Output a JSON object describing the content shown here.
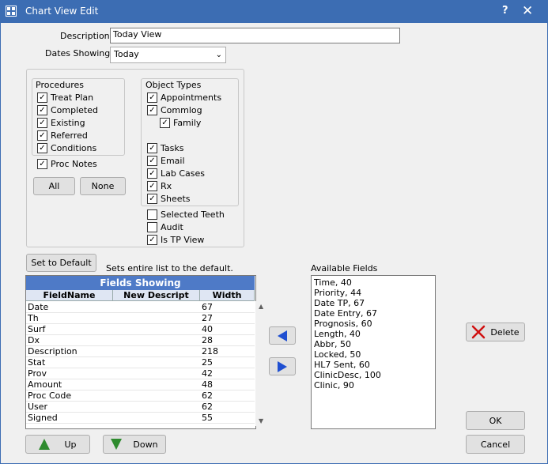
{
  "window": {
    "title": "Chart View Edit",
    "help_glyph": "?",
    "close_glyph": "✕"
  },
  "form": {
    "description_label": "Description",
    "description_value": "Today View",
    "dates_label": "Dates Showing",
    "dates_value": "Today"
  },
  "procedures": {
    "title": "Procedures",
    "items": [
      {
        "label": "Treat Plan",
        "checked": true
      },
      {
        "label": "Completed",
        "checked": true
      },
      {
        "label": "Existing",
        "checked": true
      },
      {
        "label": "Referred",
        "checked": true
      },
      {
        "label": "Conditions",
        "checked": true
      }
    ],
    "proc_notes": {
      "label": "Proc Notes",
      "checked": true
    },
    "all_label": "All",
    "none_label": "None"
  },
  "object_types": {
    "title": "Object Types",
    "items": [
      {
        "label": "Appointments",
        "checked": true
      },
      {
        "label": "Commlog",
        "checked": true
      },
      {
        "label": "Family",
        "checked": true
      },
      {
        "label": "Tasks",
        "checked": true
      },
      {
        "label": "Email",
        "checked": true
      },
      {
        "label": "Lab Cases",
        "checked": true
      },
      {
        "label": "Rx",
        "checked": true
      },
      {
        "label": "Sheets",
        "checked": true
      }
    ],
    "extras": [
      {
        "label": "Selected Teeth",
        "checked": false
      },
      {
        "label": "Audit",
        "checked": false
      },
      {
        "label": "Is TP View",
        "checked": true
      }
    ]
  },
  "defaults": {
    "button_label": "Set to Default",
    "hint": "Sets entire list to the default."
  },
  "fields_showing": {
    "title": "Fields Showing",
    "columns": [
      "FieldName",
      "New Descript",
      "Width"
    ],
    "rows": [
      {
        "name": "Date",
        "desc": "",
        "width": "67"
      },
      {
        "name": "Th",
        "desc": "",
        "width": "27"
      },
      {
        "name": "Surf",
        "desc": "",
        "width": "40"
      },
      {
        "name": "Dx",
        "desc": "",
        "width": "28"
      },
      {
        "name": "Description",
        "desc": "",
        "width": "218"
      },
      {
        "name": "Stat",
        "desc": "",
        "width": "25"
      },
      {
        "name": "Prov",
        "desc": "",
        "width": "42"
      },
      {
        "name": "Amount",
        "desc": "",
        "width": "48"
      },
      {
        "name": "Proc Code",
        "desc": "",
        "width": "62"
      },
      {
        "name": "User",
        "desc": "",
        "width": "62"
      },
      {
        "name": "Signed",
        "desc": "",
        "width": "55"
      }
    ]
  },
  "available": {
    "label": "Available Fields",
    "items": [
      "Time, 40",
      "Priority, 44",
      "Date TP, 67",
      "Date Entry, 67",
      "Prognosis, 60",
      "Length, 40",
      "Abbr, 50",
      "Locked, 50",
      "HL7 Sent, 60",
      "ClinicDesc, 100",
      "Clinic, 90"
    ]
  },
  "buttons": {
    "up": "Up",
    "down": "Down",
    "delete": "Delete",
    "ok": "OK",
    "cancel": "Cancel"
  }
}
